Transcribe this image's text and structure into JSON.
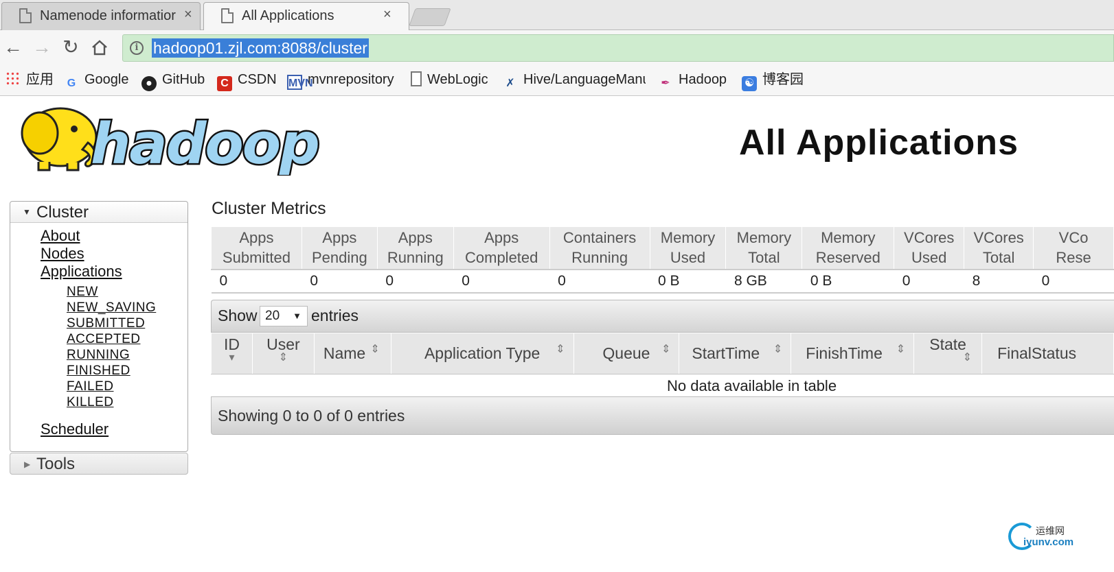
{
  "browser": {
    "tabs": [
      {
        "title": "Namenode informatior",
        "active": false
      },
      {
        "title": "All Applications",
        "active": true
      }
    ],
    "close_glyph": "×",
    "url": "hadoop01.zjl.com:8088/cluster",
    "nav_icons": [
      "back-icon",
      "forward-icon",
      "reload-icon",
      "home-icon",
      "info-icon"
    ],
    "bookmarks": [
      {
        "label": "应用",
        "icon": "apps-grid-icon"
      },
      {
        "label": "Google",
        "icon": "google-icon"
      },
      {
        "label": "GitHub",
        "icon": "github-icon"
      },
      {
        "label": "CSDN",
        "icon": "csdn-icon"
      },
      {
        "label": "mvnrepository",
        "icon": "mvn-icon"
      },
      {
        "label": "WebLogic",
        "icon": "page-icon"
      },
      {
        "label": "Hive/LanguageManu",
        "icon": "hive-icon"
      },
      {
        "label": "Hadoop",
        "icon": "feather-icon"
      },
      {
        "label": "博客园",
        "icon": "cnblogs-icon"
      }
    ]
  },
  "page": {
    "logo_text": "hadoop",
    "title": "All Applications"
  },
  "sidebar": {
    "cluster_label": "Cluster",
    "links": [
      "About",
      "Nodes",
      "Applications"
    ],
    "app_states": [
      "NEW",
      "NEW_SAVING",
      "SUBMITTED",
      "ACCEPTED",
      "RUNNING",
      "FINISHED",
      "FAILED",
      "KILLED"
    ],
    "scheduler": "Scheduler",
    "tools_label": "Tools"
  },
  "metrics": {
    "title": "Cluster Metrics",
    "headers": [
      [
        "Apps",
        "Submitted"
      ],
      [
        "Apps",
        "Pending"
      ],
      [
        "Apps",
        "Running"
      ],
      [
        "Apps",
        "Completed"
      ],
      [
        "Containers",
        "Running"
      ],
      [
        "Memory",
        "Used"
      ],
      [
        "Memory",
        "Total"
      ],
      [
        "Memory",
        "Reserved"
      ],
      [
        "VCores",
        "Used"
      ],
      [
        "VCores",
        "Total"
      ],
      [
        "VCo",
        "Rese"
      ]
    ],
    "values": [
      "0",
      "0",
      "0",
      "0",
      "0",
      "0 B",
      "8 GB",
      "0 B",
      "0",
      "8",
      "0"
    ]
  },
  "table": {
    "show_label": "Show",
    "page_size": "20",
    "entries_label": "entries",
    "columns": [
      "ID",
      "User",
      "Name",
      "Application Type",
      "Queue",
      "StartTime",
      "FinishTime",
      "State",
      "FinalStatus"
    ],
    "empty_text": "No data available in table",
    "footer_text": "Showing 0 to 0 of 0 entries"
  },
  "watermark": {
    "cn": "运维网",
    "en": "iyunv.com"
  }
}
